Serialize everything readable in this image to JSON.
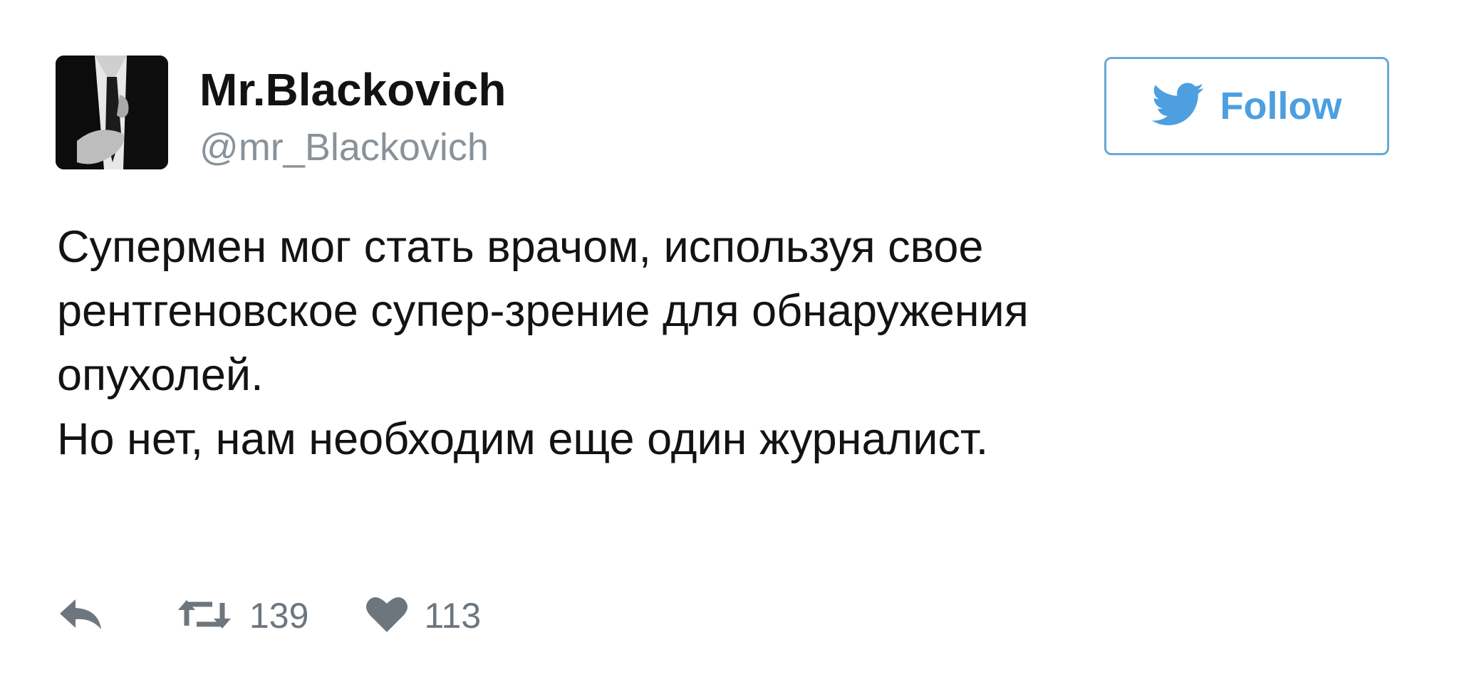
{
  "tweet": {
    "author": {
      "display_name": "Mr.Blackovich",
      "handle": "@mr_Blackovich"
    },
    "follow_button": {
      "label": "Follow",
      "icon": "twitter-bird-icon"
    },
    "text_lines": [
      "Супермен мог стать врачом, используя свое",
      "рентгеновское супер-зрение для обнаружения",
      "опухолей.",
      "Но нет, нам необходим еще один журналист."
    ],
    "actions": {
      "reply": {
        "icon": "reply-icon"
      },
      "retweet": {
        "icon": "retweet-icon",
        "count": "139"
      },
      "like": {
        "icon": "heart-icon",
        "count": "113"
      }
    }
  },
  "colors": {
    "accent": "#4d9fe0",
    "button_border": "#6aa8d6",
    "handle_gray": "#8a9299",
    "action_gray": "#6e767d"
  }
}
